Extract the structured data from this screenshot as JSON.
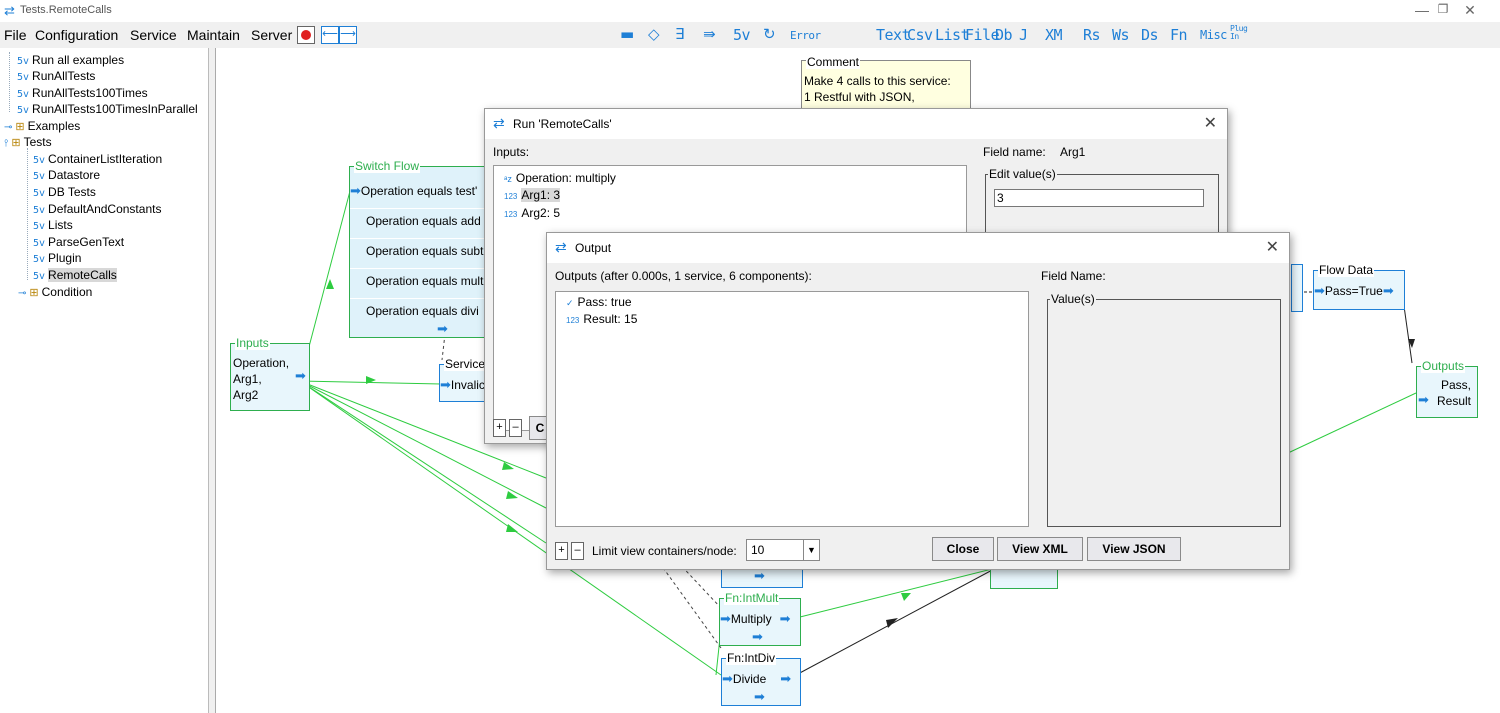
{
  "window": {
    "title": "Tests.RemoteCalls"
  },
  "menu": {
    "file": "File",
    "configuration": "Configuration",
    "service": "Service",
    "maintain": "Maintain",
    "server": "Server"
  },
  "toolbar_text": [
    "5v",
    "Error",
    "Text",
    "Csv",
    "List",
    "File",
    "Db",
    "J",
    "XM",
    "Rs",
    "Ws",
    "Ds",
    "Fn",
    "Misc",
    "Plug In"
  ],
  "tree": {
    "items": [
      "Run all examples",
      "RunAllTests",
      "RunAllTests100Times",
      "RunAllTests100TimesInParallel",
      "Examples",
      "Tests",
      "ContainerListIteration",
      "Datastore",
      "DB Tests",
      "DefaultAndConstants",
      "Lists",
      "ParseGenText",
      "Plugin",
      "RemoteCalls",
      "Condition"
    ]
  },
  "canvas": {
    "comment_title": "Comment",
    "comment_lines": [
      "Make 4 calls to this service:",
      "1 Restful with JSON,"
    ],
    "switch_title": "Switch Flow",
    "switch_items": [
      "Operation equals test'",
      "Operation equals add",
      "Operation equals subt",
      "Operation equals mult",
      "Operation equals divi"
    ],
    "inputs_title": "Inputs",
    "inputs_lines": [
      "Operation,",
      "Arg1,",
      "Arg2"
    ],
    "service_title": "Service",
    "service_label": "Invalic",
    "flow_data_title": "Flow Data",
    "flow_data_label": "Pass=True",
    "outputs_title": "Outputs",
    "outputs_lines": [
      "Pass,",
      "Result"
    ],
    "intmult_title": "Fn:IntMult",
    "intmult_label": "Multiply",
    "intdiv_title": "Fn:IntDiv",
    "intdiv_label": "Divide"
  },
  "run_dialog": {
    "title": "Run 'RemoteCalls'",
    "inputs_label": "Inputs:",
    "items": [
      "Operation: multiply",
      "Arg1: 3",
      "Arg2: 5"
    ],
    "field_name_label": "Field name:",
    "field_name_value": "Arg1",
    "edit_values_label": "Edit value(s)",
    "edit_value": "3",
    "plus": "+",
    "minus": "–",
    "c_btn": "C"
  },
  "output_dialog": {
    "title": "Output",
    "summary": "Outputs (after 0.000s, 1 service, 6 components):",
    "items": [
      "Pass: true",
      "Result: 15"
    ],
    "field_name_label": "Field Name:",
    "values_label": "Value(s)",
    "plus": "+",
    "minus": "–",
    "limit_label": "Limit view containers/node:",
    "limit_value": "10",
    "close": "Close",
    "view_xml": "View XML",
    "view_json": "View JSON"
  }
}
